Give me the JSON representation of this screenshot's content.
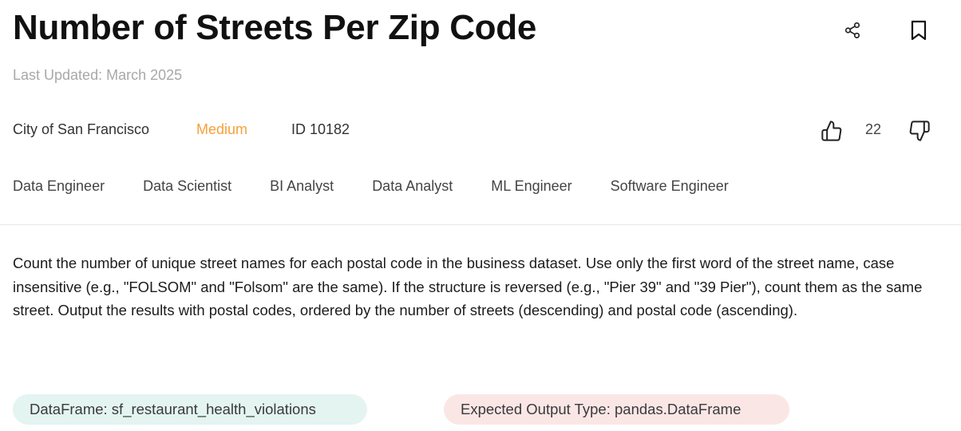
{
  "header": {
    "title": "Number of Streets Per Zip Code",
    "last_updated": "Last Updated: March 2025"
  },
  "meta": {
    "company": "City of San Francisco",
    "difficulty": "Medium",
    "id": "ID 10182",
    "votes": "22"
  },
  "roles": [
    "Data Engineer",
    "Data Scientist",
    "BI Analyst",
    "Data Analyst",
    "ML Engineer",
    "Software Engineer"
  ],
  "description": "Count the number of unique street names for each postal code in the business dataset. Use only the first word of the street name, case insensitive (e.g., \"FOLSOM\" and \"Folsom\" are the same). If the structure is reversed (e.g., \"Pier 39\" and \"39 Pier\"), count them as the same street. Output the results with postal codes, ordered by the number of streets (descending) and postal code (ascending).",
  "chips": {
    "dataframe": "DataFrame: sf_restaurant_health_violations",
    "output_type": "Expected Output Type: pandas.DataFrame"
  },
  "colors": {
    "difficulty": "#f5a13a",
    "dataframe_chip_bg": "#e3f4f1",
    "output_chip_bg": "#fbe6e6"
  },
  "icons": {
    "share": "share-icon",
    "bookmark": "bookmark-icon",
    "upvote": "thumbs-up-icon",
    "downvote": "thumbs-down-icon"
  }
}
